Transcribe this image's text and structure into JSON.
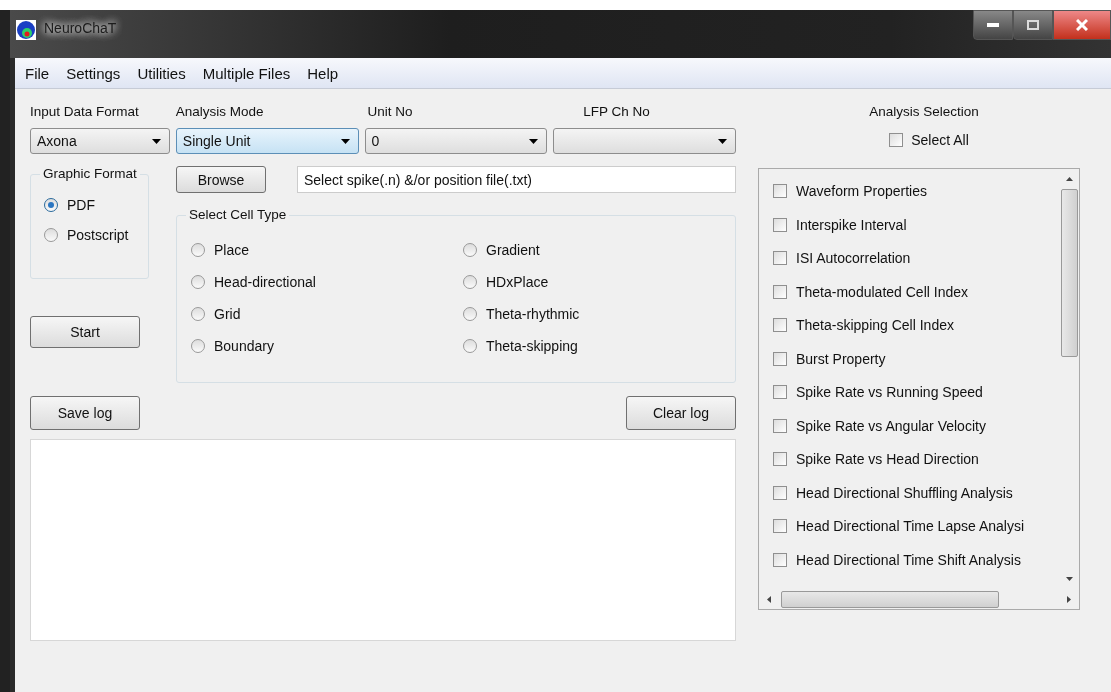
{
  "window": {
    "title": "NeuroChaT"
  },
  "menu": [
    "File",
    "Settings",
    "Utilities",
    "Multiple Files",
    "Help"
  ],
  "combos": [
    {
      "label": "Input Data Format",
      "value": "Axona",
      "selected": false
    },
    {
      "label": "Analysis Mode",
      "value": "Single Unit",
      "selected": true
    },
    {
      "label": "Unit No",
      "value": "0",
      "selected": false
    },
    {
      "label": "LFP Ch No",
      "selected": false
    }
  ],
  "graphic_format": {
    "title": "Graphic Format",
    "options": [
      {
        "label": "PDF",
        "selected": true
      },
      {
        "label": "Postscript",
        "selected": false
      }
    ]
  },
  "browse_button": "Browse",
  "file_field": {
    "value": "Select spike(.n) &/or position file(.txt)"
  },
  "cell_type": {
    "title": "Select Cell Type",
    "options": [
      {
        "label": "Place",
        "selected": false
      },
      {
        "label": "Head-directional",
        "selected": false
      },
      {
        "label": "Grid",
        "selected": false
      },
      {
        "label": "Boundary",
        "selected": false
      },
      {
        "label": "Gradient",
        "selected": false
      },
      {
        "label": "HDxPlace",
        "selected": false
      },
      {
        "label": "Theta-rhythmic",
        "selected": false
      },
      {
        "label": "Theta-skipping",
        "selected": false
      }
    ]
  },
  "start_button": "Start",
  "save_log_button": "Save log",
  "clear_log_button": "Clear log",
  "analysis_selection": {
    "title": "Analysis Selection",
    "select_all": {
      "label": "Select All",
      "checked": false
    },
    "items": [
      {
        "label": "Waveform Properties",
        "checked": false
      },
      {
        "label": "Interspike Interval",
        "checked": false
      },
      {
        "label": "ISI Autocorrelation",
        "checked": false
      },
      {
        "label": "Theta-modulated Cell Index",
        "checked": false
      },
      {
        "label": "Theta-skipping Cell Index",
        "checked": false
      },
      {
        "label": "Burst Property",
        "checked": false
      },
      {
        "label": "Spike Rate vs Running Speed",
        "checked": false
      },
      {
        "label": "Spike Rate vs Angular Velocity",
        "checked": false
      },
      {
        "label": "Spike Rate vs Head Direction",
        "checked": false
      },
      {
        "label": "Head Directional Shuffling Analysis",
        "checked": false
      },
      {
        "label": "Head Directional Time Lapse Analysi",
        "checked": false
      },
      {
        "label": "Head Directional Time Shift Analysis",
        "checked": false
      }
    ]
  }
}
